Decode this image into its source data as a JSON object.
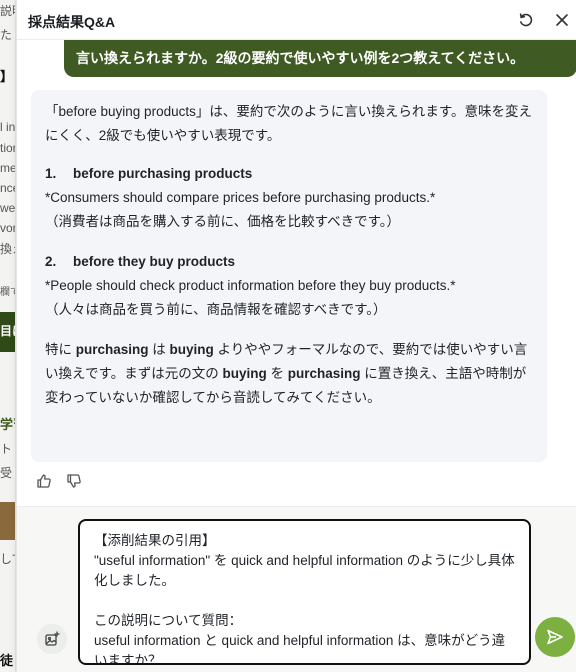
{
  "background_page": {
    "fragments": [
      "説明",
      "た",
      "】",
      "l in",
      "tior",
      "me",
      "nce",
      "we",
      "vor",
      "換え",
      "欄で",
      "目に",
      "学習",
      "ト",
      "受",
      "して",
      "徒"
    ]
  },
  "panel": {
    "title": "採点結果Q&A",
    "refresh_icon": "refresh-icon",
    "close_icon": "close-icon"
  },
  "user_message": "言い換えられますか。2級の要約で使いやすい例を2つ教えてください。",
  "assistant": {
    "intro": "「before buying products」は、要約で次のように言い換えられます。意味を変えにくく、2級でも使いやすい表現です。",
    "items": [
      {
        "number": "1.",
        "phrase": "before purchasing products",
        "example": "*Consumers should compare prices before purchasing products.*",
        "translation": "（消費者は商品を購入する前に、価格を比較すべきです。）"
      },
      {
        "number": "2.",
        "phrase": "before they buy products",
        "example": "*People should check product information before they buy products.*",
        "translation": "（人々は商品を買う前に、商品情報を確認すべきです。）"
      }
    ],
    "closing_segments": {
      "s1": "特に ",
      "b1": "purchasing",
      "s2": " は ",
      "b2": "buying",
      "s3": " よりややフォーマルなので、要約では使いやすい言い換えです。まずは元の文の ",
      "b3": "buying",
      "s4": " を ",
      "b4": "purchasing",
      "s5": " に置き換え、主語や時制が変わっていないか確認してから音読してみてください。"
    }
  },
  "reactions": {
    "like_icon": "thumbs-up-icon",
    "dislike_icon": "thumbs-down-icon"
  },
  "composer": {
    "value": "【添削結果の引用】\n\"useful information\" を quick and helpful information のように少し具体化しました。\n\nこの説明について質問：\nuseful information と quick and helpful information は、意味がどう違いますか？",
    "attach_icon": "image-add-icon",
    "send_icon": "send-icon"
  },
  "colors": {
    "user_bubble": "#3f5a22",
    "send_button": "#7cb041",
    "assistant_bg": "#f3f5f8"
  }
}
